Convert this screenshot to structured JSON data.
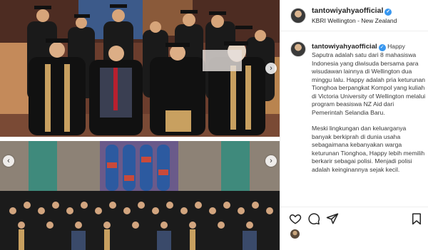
{
  "header": {
    "username": "tantowiyahyaofficial",
    "location": "KBRI Wellington - New Zealand"
  },
  "caption": {
    "username": "tantowiyahyaofficial",
    "paragraph_1": " Happy Saputra adalah satu dari 8 mahasiswa Indonesia yang diwisuda bersama para wisudawan lainnya di Wellington dua minggu lalu. Happy adalah pria keturunan Tionghoa berpangkat Kompol yang kuliah di Victoria University of Wellington melalui program beasiswa NZ Aid dari Pemerintah Selandia Baru.",
    "paragraph_2": "Meski lingkungan dan keluarganya banyak berkiprah di dunia usaha sebagaimana kebanyakan warga keturunan Tionghoa, Happy lebih memilih berkarir sebagai polisi. Menjadi polisi adalah keinginannya sejak kecil."
  },
  "icons": {
    "verified": "verified-badge-icon",
    "like": "heart-icon",
    "comment": "comment-icon",
    "share": "paper-plane-icon",
    "save": "bookmark-icon",
    "prev": "chevron-left-icon",
    "next": "chevron-right-icon"
  },
  "colors": {
    "verified": "#3897f0",
    "text": "#262626",
    "divider": "#efefef"
  }
}
